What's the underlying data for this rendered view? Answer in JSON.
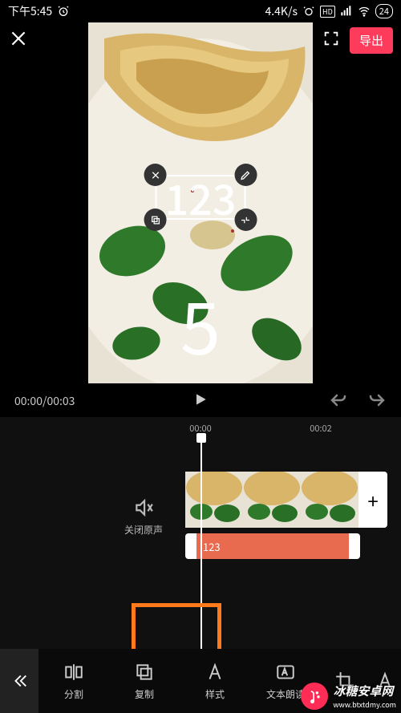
{
  "status": {
    "time": "下午5:45",
    "speed": "4.4K/s",
    "battery": "24"
  },
  "topbar": {
    "export_label": "导出"
  },
  "preview": {
    "text_content": "123",
    "countdown": "5"
  },
  "controls": {
    "current_time": "00:00",
    "total_time": "00:03"
  },
  "ruler": {
    "mark_0": "00:00",
    "mark_2": "00:02"
  },
  "sound_off_label": "关闭原声",
  "text_track_label": "123",
  "toolbar": {
    "split": "分割",
    "copy": "复制",
    "style": "样式",
    "tts": "文本朗读"
  },
  "watermark": {
    "name": "冰糖安卓网",
    "url": "www.btxtdmy.com"
  }
}
